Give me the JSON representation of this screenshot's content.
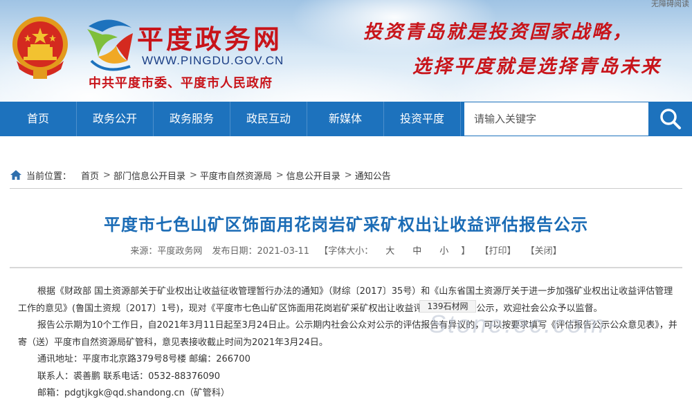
{
  "header": {
    "corner_text": "无障碍阅读",
    "site_name": "平度政务网",
    "site_url": "WWW.PINGDU.GOV.CN",
    "org": "中共平度市委、平度市人民政府",
    "slogan_line1": "投资青岛就是投资国家战略，",
    "slogan_line2": "选择平度就是选择青岛未来"
  },
  "nav": {
    "items": [
      "首页",
      "政务公开",
      "政务服务",
      "政民互动",
      "新媒体",
      "投资平度"
    ],
    "search_placeholder": "请输入关键字"
  },
  "breadcrumb": {
    "label": "当前位置：",
    "items": [
      "首页",
      "部门信息公开目录",
      "平度市自然资源局",
      "信息公开目录",
      "通知公告"
    ]
  },
  "article": {
    "title": "平度市七色山矿区饰面用花岗岩矿采矿权出让收益评估报告公示",
    "source": "来源：平度政务网",
    "date": "发布日期：2021-03-11",
    "font_label": "【字体大小：",
    "font_large": "大",
    "font_medium": "中",
    "font_small": "小",
    "font_close": "】",
    "print": "【打印】",
    "close": "【关闭】",
    "paragraphs": [
      "根据《财政部 国土资源部关于矿业权出让收益征收管理暂行办法的通知》（财综〔2017〕35号）和《山东省国土资源厅关于进一步加强矿业权出让收益评估管理工作的意见》(鲁国土资规〔2017〕1号)，现对《平度市七色山矿区饰面用花岗岩矿采矿权出让收益评估报告》进行公示，欢迎社会公众予以监督。",
      "报告公示期为10个工作日，自2021年3月11日起至3月24日止。公示期内社会公众对公示的评估报告有异议的，可以按要求填写《评估报告公示公众意见表》，并寄（送）平度市自然资源局矿管科，意见表接收截止时间为2021年3月24日。",
      "通讯地址：平度市北京路379号8号楼  邮编：266700",
      "联系人：裘善鹏  联系电话：0532-88376090",
      "邮箱：pdgtjkgk@qd.shandong.cn（矿管科）"
    ]
  },
  "watermark": {
    "badge": "139石材网",
    "text": "Stone.ec.com"
  }
}
